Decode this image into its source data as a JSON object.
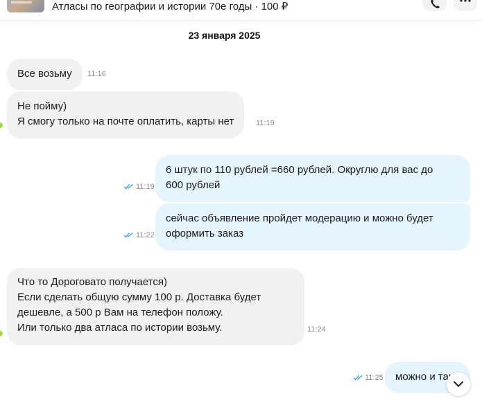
{
  "header": {
    "title": "Атласы по географии и истории 70е годы · 100 ₽",
    "icons": [
      "item-thumbnail",
      "phone-icon",
      "more-icon"
    ]
  },
  "date_divider": "23 января 2025",
  "messages": [
    {
      "direction": "in",
      "lines": [
        "Все возьму"
      ],
      "time": "11:16"
    },
    {
      "direction": "in",
      "lines": [
        "Не пойму)",
        "Я смогу только на почте оплатить, карты нет"
      ],
      "time": "11:19"
    },
    {
      "direction": "out",
      "lines": [
        "6 штук по 110 рублей =660 рублей. Округлю для вас до",
        "600 рублей"
      ],
      "time": "11:19",
      "read": true
    },
    {
      "direction": "out",
      "lines": [
        "сейчас объявление пройдет модерацию и можно будет",
        "оформить заказ"
      ],
      "time": "11:22",
      "read": true
    },
    {
      "direction": "in",
      "lines": [
        "Что то Дороговато получается)",
        "Если сделать общую сумму 100 р. Доставка будет",
        "дешевле, а 500 р Вам на телефон положу.",
        "Или только два атласа по истории возьму."
      ],
      "time": "11:24"
    },
    {
      "direction": "out",
      "lines": [
        "можно и так"
      ],
      "time": "11:25",
      "read": true
    }
  ],
  "colors": {
    "incoming_bubble": "#f2f1f0",
    "outgoing_bubble": "#e6f4fd",
    "read_check": "#3aa5e8",
    "online_dot": "#a6d84a"
  }
}
